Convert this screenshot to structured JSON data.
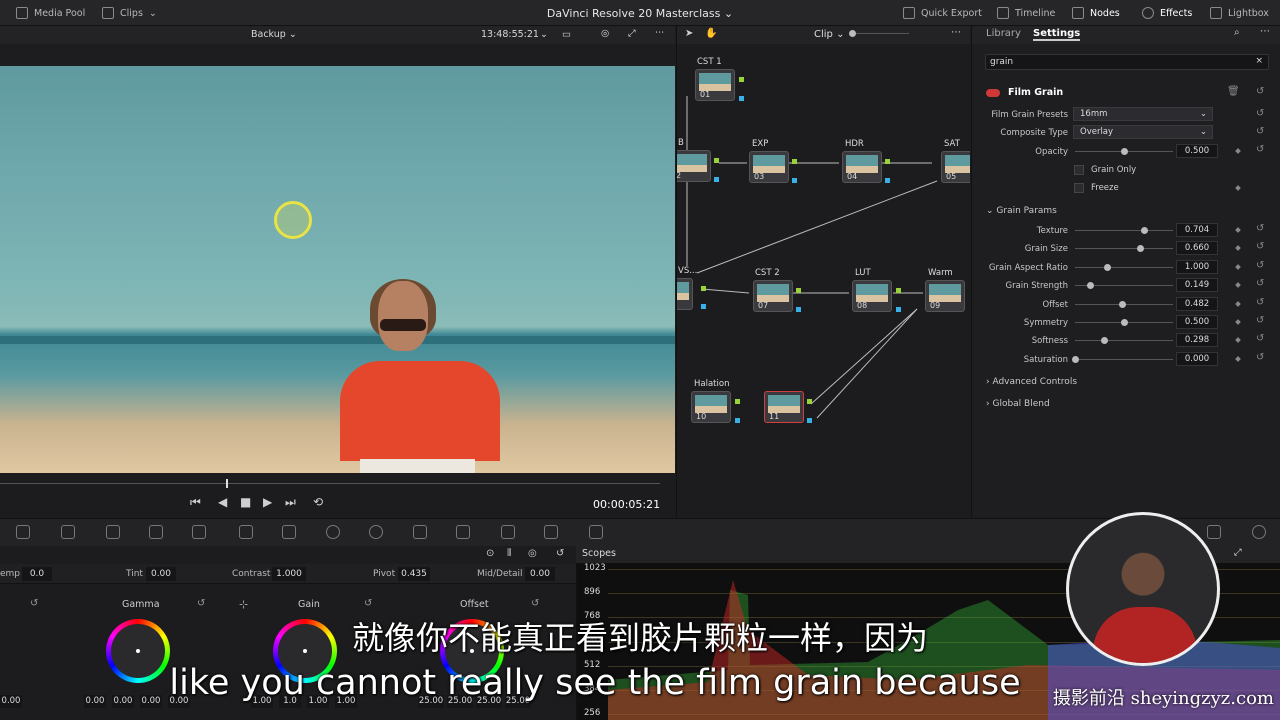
{
  "topbar": {
    "media_pool": "Media Pool",
    "clips": "Clips",
    "title": "DaVinci Resolve 20 Masterclass",
    "quick_export": "Quick Export",
    "timeline": "Timeline",
    "nodes": "Nodes",
    "effects": "Effects",
    "lightbox": "Lightbox"
  },
  "viewer": {
    "backup_label": "Backup",
    "timecode": "13:48:55:21",
    "duration_tc": "00:00:05:21"
  },
  "nodes_panel": {
    "mode": "Clip",
    "nodes": [
      {
        "label": "CST 1",
        "num": "01"
      },
      {
        "label": "B",
        "num": "2"
      },
      {
        "label": "EXP",
        "num": "03"
      },
      {
        "label": "HDR",
        "num": "04"
      },
      {
        "label": "SAT",
        "num": "05"
      },
      {
        "label": "VS...",
        "num": ""
      },
      {
        "label": "CST 2",
        "num": "07"
      },
      {
        "label": "LUT",
        "num": "08"
      },
      {
        "label": "Warm",
        "num": "09"
      },
      {
        "label": "Halation",
        "num": "10"
      },
      {
        "label": "",
        "num": "11"
      }
    ]
  },
  "settings": {
    "tabs": [
      "Library",
      "Settings"
    ],
    "search_value": "grain",
    "effect_name": "Film Grain",
    "presets_label": "Film Grain Presets",
    "presets_value": "16mm",
    "composite_label": "Composite Type",
    "composite_value": "Overlay",
    "opacity_label": "Opacity",
    "opacity_value": "0.500",
    "opacity_level": 0.5,
    "grain_only": "Grain Only",
    "freeze": "Freeze",
    "grain_params": "Grain Params",
    "params": [
      {
        "label": "Texture",
        "value": "0.704",
        "level": 0.704
      },
      {
        "label": "Grain Size",
        "value": "0.660",
        "level": 0.66
      },
      {
        "label": "Grain Aspect Ratio",
        "value": "1.000",
        "level": 0.33
      },
      {
        "label": "Grain Strength",
        "value": "0.149",
        "level": 0.149
      },
      {
        "label": "Offset",
        "value": "0.482",
        "level": 0.482
      },
      {
        "label": "Symmetry",
        "value": "0.500",
        "level": 0.5
      },
      {
        "label": "Softness",
        "value": "0.298",
        "level": 0.298
      },
      {
        "label": "Saturation",
        "value": "0.000",
        "level": 0.0
      }
    ],
    "advanced_controls": "Advanced Controls",
    "global_blend": "Global Blend"
  },
  "primaries": {
    "temp_label": "emp",
    "temp_value": "0.0",
    "tint_label": "Tint",
    "tint_value": "0.00",
    "contrast_label": "Contrast",
    "contrast_value": "1.000",
    "pivot_label": "Pivot",
    "pivot_value": "0.435",
    "middetail_label": "Mid/Detail",
    "middetail_value": "0.00",
    "wheels": [
      {
        "label": "Gamma",
        "values": [
          "0.00",
          "0.00",
          "0.00",
          "0.00"
        ]
      },
      {
        "label": "Gain",
        "values": [
          "1.00",
          "1.0",
          "1.00",
          "1.00"
        ]
      },
      {
        "label": "Offset",
        "values": [
          "25.00",
          "25.00",
          "25.00",
          "25.00"
        ]
      }
    ],
    "lift_value": "0.00"
  },
  "scopes": {
    "title": "Scopes",
    "scale": [
      "1023",
      "896",
      "768",
      "640",
      "512",
      "384",
      "256"
    ]
  },
  "subtitles": {
    "chinese": "就像你不能真正看到胶片颗粒一样，因为",
    "english": "like you cannot really see the film grain because"
  },
  "watermark": "摄影前沿 sheyingzyz.com"
}
